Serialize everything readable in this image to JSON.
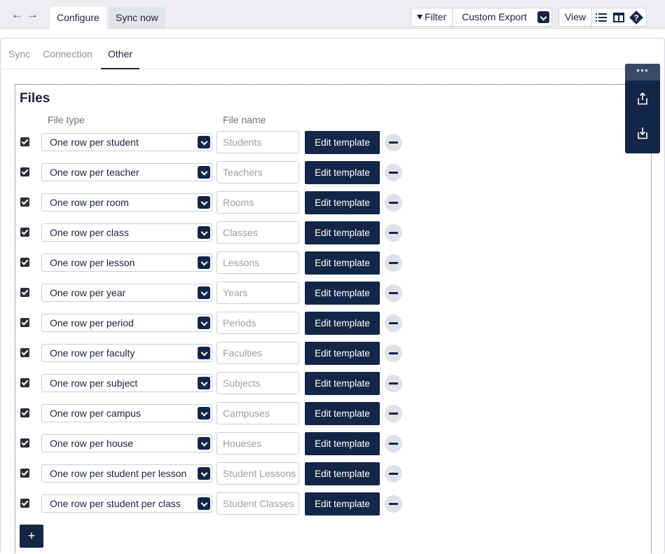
{
  "toolbar": {
    "back_icon": "arrow-left-icon",
    "forward_icon": "arrow-right-icon",
    "tabs": [
      {
        "label": "Configure",
        "active": true
      },
      {
        "label": "Sync now",
        "active": false
      }
    ],
    "filter_label": "Filter",
    "export_selected": "Custom Export",
    "view_label": "View",
    "view_icons": [
      "list-icon",
      "table-layout-icon",
      "help-icon"
    ]
  },
  "subtabs": [
    {
      "label": "Sync",
      "active": false
    },
    {
      "label": "Connection",
      "active": false
    },
    {
      "label": "Other",
      "active": true
    }
  ],
  "files": {
    "title": "Files",
    "col_file_type": "File type",
    "col_file_name": "File name",
    "edit_label": "Edit template",
    "add_label": "+",
    "rows": [
      {
        "checked": true,
        "type": "One row per student",
        "name": "Students"
      },
      {
        "checked": true,
        "type": "One row per teacher",
        "name": "Teachers"
      },
      {
        "checked": true,
        "type": "One row per room",
        "name": "Rooms"
      },
      {
        "checked": true,
        "type": "One row per class",
        "name": "Classes"
      },
      {
        "checked": true,
        "type": "One row per lesson",
        "name": "Lessons"
      },
      {
        "checked": true,
        "type": "One row per year",
        "name": "Years"
      },
      {
        "checked": true,
        "type": "One row per period",
        "name": "Periods"
      },
      {
        "checked": true,
        "type": "One row per faculty",
        "name": "Faculties"
      },
      {
        "checked": true,
        "type": "One row per subject",
        "name": "Subjects"
      },
      {
        "checked": true,
        "type": "One row per campus",
        "name": "Campuses"
      },
      {
        "checked": true,
        "type": "One row per house",
        "name": "Houeses"
      },
      {
        "checked": true,
        "type": "One row per student per lesson",
        "name": "Student Lessons"
      },
      {
        "checked": true,
        "type": "One row per student per class",
        "name": "Student Classes"
      }
    ]
  },
  "side_toolbar": {
    "handle": "•••",
    "icons": [
      "export-icon",
      "import-icon"
    ]
  },
  "colors": {
    "primary": "#132647",
    "toolbar_bg": "#eceef1",
    "muted_text": "#8a919c"
  }
}
